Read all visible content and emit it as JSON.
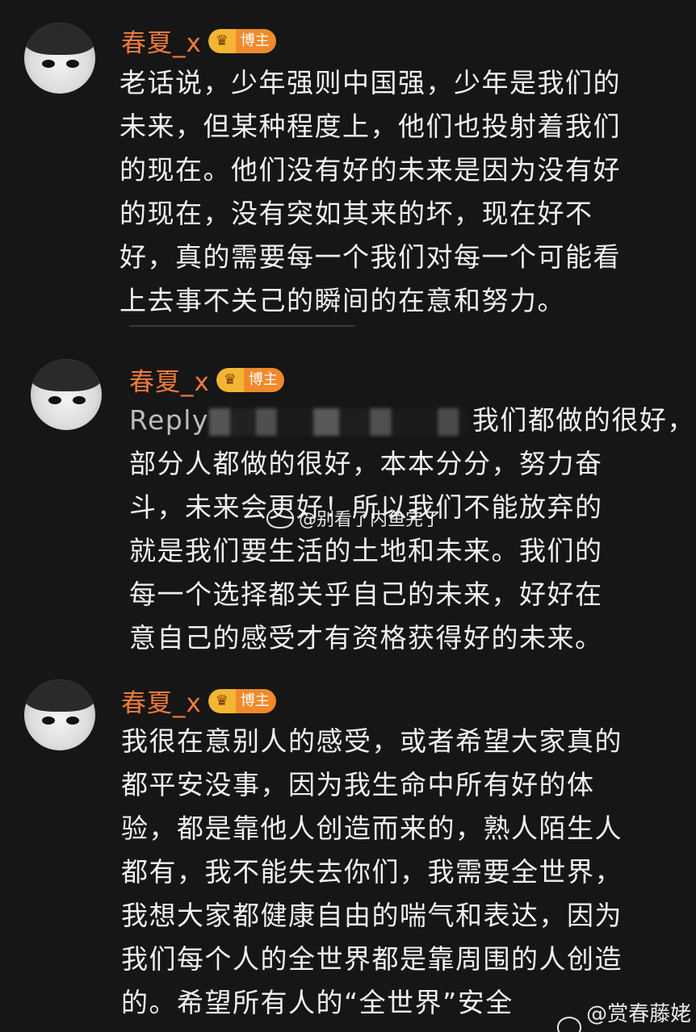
{
  "comments": [
    {
      "username": "春夏_x",
      "badge": "博主",
      "text": "老话说，少年强则中国强，少年是我们的\n未来，但某种程度上，他们也投射着我们\n的现在。他们没有好的未来是因为没有好\n的现在，没有突如其来的坏，现在好不\n好，真的需要每一个我们对每一个可能看\n上去事不关己的瞬间的在意和努力。"
    },
    {
      "username": "春夏_x",
      "badge": "博主",
      "reply_prefix": "Reply",
      "text_line1": "我们都做的很好，大",
      "text": "部分人都做的很好，本本分分，努力奋\n斗，未来会更好！所以我们不能放弃的\n就是我们要生活的土地和未来。我们的\n每一个选择都关乎自己的未来，好好在\n意自己的感受才有资格获得好的未来。"
    },
    {
      "username": "春夏_x",
      "badge": "博主",
      "text": "我很在意别人的感受，或者希望大家真的\n都平安没事，因为我生命中所有好的体\n验，都是靠他人创造而来的，熟人陌生人\n都有，我不能失去你们，我需要全世界，\n我想大家都健康自由的喘气和表达，因为\n我们每个人的全世界都是靠周围的人创造\n的。希望所有人的“全世界”安全"
    }
  ],
  "watermarks": {
    "middle": "@别看了内鱼完了",
    "bottom": "@赏春藤姥姥"
  },
  "colors": {
    "background": "#161616",
    "username": "#f07a3a",
    "badge": "#f08a2a",
    "text": "#f0f0f0"
  }
}
